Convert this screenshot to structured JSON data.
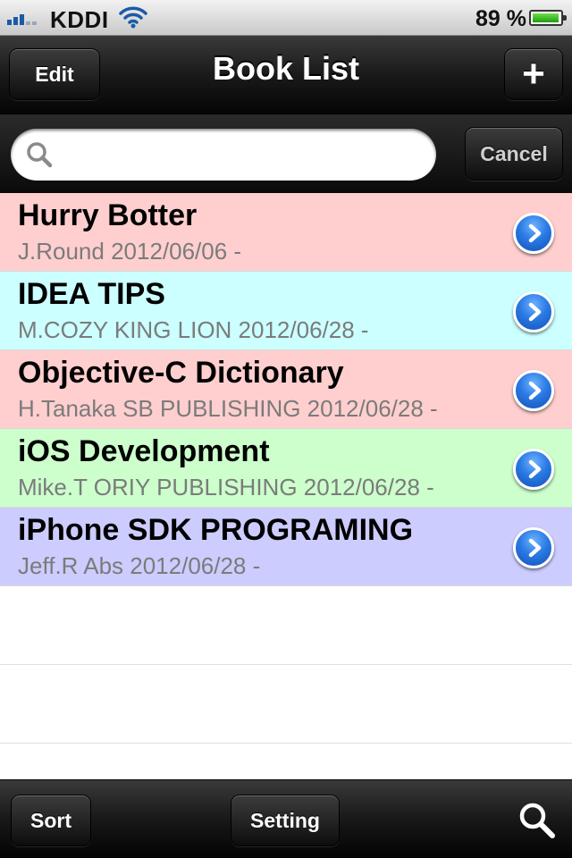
{
  "status_bar": {
    "carrier": "KDDI",
    "battery_percent": "89 %",
    "signal_icon": "signal-bars-icon",
    "wifi_icon": "wifi-icon",
    "battery_icon": "battery-icon"
  },
  "nav_bar": {
    "title": "Book List",
    "edit_label": "Edit",
    "add_label": "+"
  },
  "search": {
    "placeholder": "",
    "cancel_label": "Cancel",
    "icon": "search-icon"
  },
  "books": [
    {
      "title": "Hurry Botter",
      "subtitle": "J.Round  2012/06/06 -",
      "color": "#ffcfcf"
    },
    {
      "title": "IDEA TIPS",
      "subtitle": "M.COZY KING LION  2012/06/28 -",
      "color": "#ccffff"
    },
    {
      "title": "Objective-C Dictionary",
      "subtitle": "H.Tanaka SB PUBLISHING 2012/06/28 -",
      "color": "#ffcfcf"
    },
    {
      "title": "iOS Development",
      "subtitle": "Mike.T ORIY PUBLISHING 2012/06/28 -",
      "color": "#ccffcc"
    },
    {
      "title": "iPhone SDK PROGRAMING",
      "subtitle": "Jeff.R Abs 2012/06/28 -",
      "color": "#ccccff"
    }
  ],
  "toolbar": {
    "sort_label": "Sort",
    "setting_label": "Setting",
    "search_icon": "search-icon"
  },
  "colors": {
    "bar_dark": "#111111",
    "disclosure_blue": "#2a7ae4",
    "subtitle_gray": "#7b7b7b"
  }
}
